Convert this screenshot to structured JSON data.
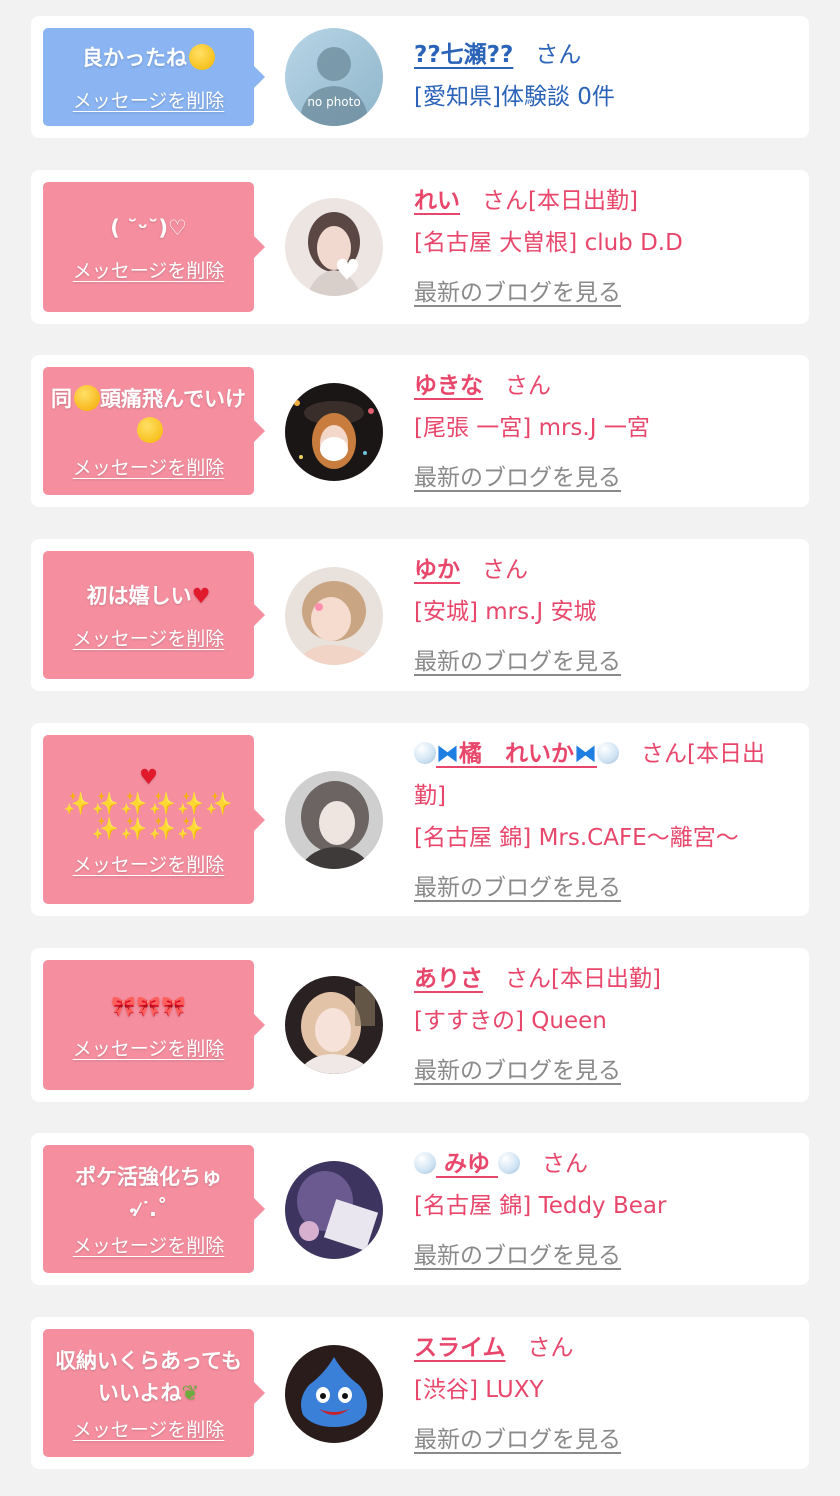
{
  "colors": {
    "page_bg": "#f2f2f2",
    "card_bg": "#ffffff",
    "bubble_blue": "#8ab4f2",
    "bubble_pink": "#f58fa0",
    "name_pink": "#e8476b",
    "name_blue": "#2a63b8",
    "blog_link_gray": "#8a8a8a"
  },
  "delete_label": "メッセージを削除",
  "honorific": "さん",
  "blog_label": "最新のブログを見る",
  "items": [
    {
      "message": "良かったね",
      "message_emoji": "smiling-face-icon",
      "name": "??七瀬??",
      "status": "",
      "shop": "[愛知県]体験談 0件",
      "avatar_caption": "no photo",
      "has_blog": false
    },
    {
      "message": "( ˘ᵕ˘)♡",
      "name": "れい",
      "status": "[本日出勤]",
      "shop": "[名古屋 大曽根] club D.D",
      "has_blog": true
    },
    {
      "message_part1": "同",
      "message_emoji1": "screaming-face-icon",
      "message_part2": "頭痛飛んでいけ",
      "message_emoji2": "kissing-face-icon",
      "name": "ゆきな",
      "status": "",
      "shop": "[尾張 一宮] mrs.J 一宮",
      "has_blog": true
    },
    {
      "message": "初は嬉しい",
      "message_emoji": "red-heart-icon",
      "name": "ゆか",
      "status": "",
      "shop": "[安城] mrs.J 安城",
      "has_blog": true
    },
    {
      "message_line1": "❤️",
      "message_line2": "✨✨✨✨✨✨",
      "message_line3": "✨✨✨✨",
      "name": "橘　れいか",
      "name_decor": "bubble-butterfly",
      "status": "[本日出勤]",
      "shop": "[名古屋 錦] Mrs.CAFE〜離宮〜",
      "has_blog": true
    },
    {
      "message": "🎀🎀🎀",
      "name": "ありさ",
      "status": "[本日出勤]",
      "shop": "[すすきの] Queen",
      "has_blog": true
    },
    {
      "message": "ポケ活強化ちゅ\n৵ᐝ.˚",
      "name": "みゆ",
      "name_decor": "bubble",
      "status": "",
      "shop": "[名古屋 錦] Teddy Bear",
      "has_blog": true
    },
    {
      "message": "収納いくらあってもいいよね",
      "message_emoji": "leaf-icon",
      "name": "スライム",
      "status": "",
      "shop": "[渋谷] LUXY",
      "has_blog": true
    }
  ]
}
